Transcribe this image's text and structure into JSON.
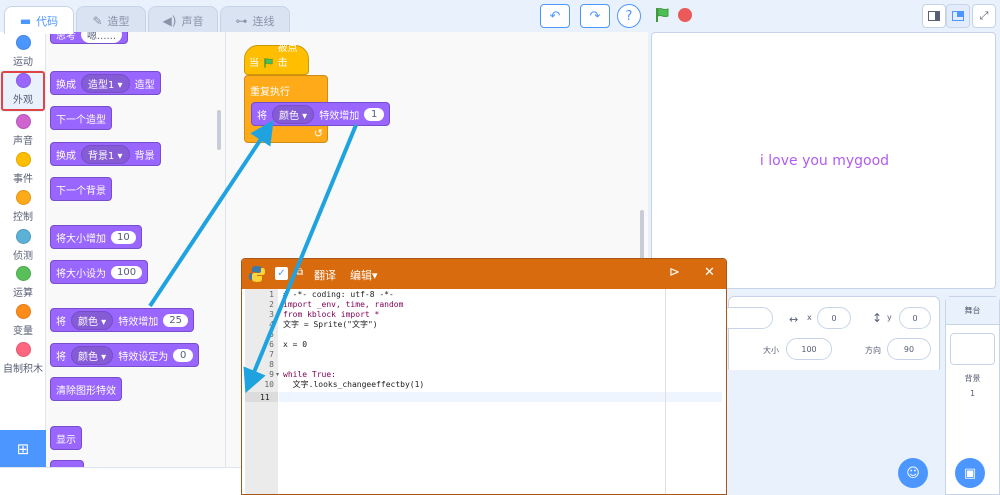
{
  "tabs": [
    {
      "label": "代码",
      "icon": "code-icon"
    },
    {
      "label": "造型",
      "icon": "brush-icon"
    },
    {
      "label": "声音",
      "icon": "speaker-icon"
    },
    {
      "label": "连线",
      "icon": "wire-icon"
    }
  ],
  "controls": {
    "undo": "↶",
    "redo": "↷",
    "help": "?"
  },
  "categories": [
    {
      "label": "运动",
      "color": "#4c97ff"
    },
    {
      "label": "外观",
      "color": "#9966ff"
    },
    {
      "label": "声音",
      "color": "#cf63cf"
    },
    {
      "label": "事件",
      "color": "#ffbf00"
    },
    {
      "label": "控制",
      "color": "#ffab19"
    },
    {
      "label": "侦测",
      "color": "#5cb1d6"
    },
    {
      "label": "运算",
      "color": "#59c059"
    },
    {
      "label": "变量",
      "color": "#ff8c1a"
    },
    {
      "label": "自制积木",
      "color": "#ff6680"
    }
  ],
  "palette": {
    "think_fragment": "思考",
    "think_value": "嗯......",
    "switch_costume": {
      "pre": "换成",
      "dd": "造型1",
      "post": "造型"
    },
    "next_costume": "下一个造型",
    "switch_backdrop": {
      "pre": "换成",
      "dd": "背景1",
      "post": "背景"
    },
    "next_backdrop": "下一个背景",
    "change_size": {
      "pre": "将大小增加",
      "val": "10"
    },
    "set_size": {
      "pre": "将大小设为",
      "val": "100"
    },
    "change_effect": {
      "pre": "将",
      "dd": "颜色",
      "post": "特效增加",
      "val": "25"
    },
    "set_effect": {
      "pre": "将",
      "dd": "颜色",
      "post": "特效设定为",
      "val": "0"
    },
    "clear_effects": "清除图形特效",
    "show": "显示"
  },
  "script": {
    "hat": {
      "pre": "当",
      "post": "被点击"
    },
    "forever": "重复执行",
    "inner": {
      "pre": "将",
      "dd": "颜色",
      "post": "特效增加",
      "val": "1"
    }
  },
  "stage": {
    "text": "i love you mygood",
    "text_color": "#b15cf2"
  },
  "sprite_info": {
    "x_label": "x",
    "x_val": "0",
    "y_label": "y",
    "y_val": "0",
    "size_label": "大小",
    "size_val": "100",
    "dir_label": "方向",
    "dir_val": "90"
  },
  "stage_selector": {
    "title": "舞台",
    "backdrops_label": "背景",
    "backdrops_count": "1"
  },
  "python_dialog": {
    "translate": "翻译",
    "edit": "编辑",
    "lines": [
      "1",
      "2",
      "3",
      "4",
      "5",
      "6",
      "7",
      "8",
      "9",
      "10",
      "11"
    ],
    "code": [
      "# -*- coding: utf-8 -*-",
      "import _env, time, random",
      "from kblock import *",
      "文字 = Sprite(\"文字\")",
      "",
      "x = 0",
      "",
      "",
      "while True:",
      "  文字.looks_changeeffectby(1)",
      ""
    ]
  }
}
